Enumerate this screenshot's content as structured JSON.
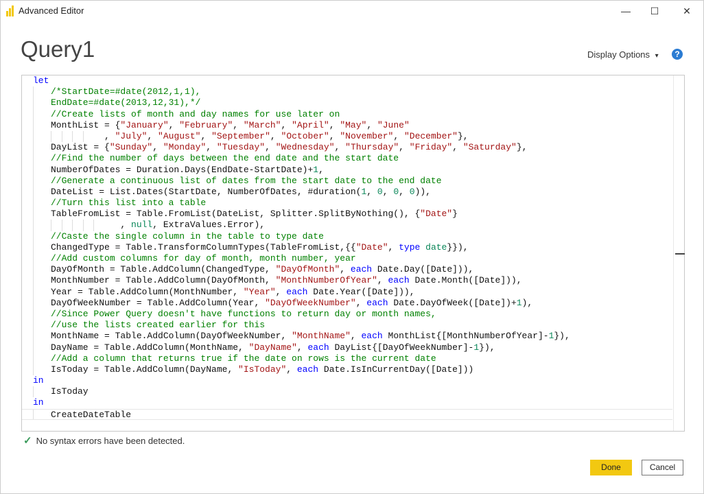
{
  "window": {
    "title": "Advanced Editor",
    "minimize": "—",
    "maximize": "☐",
    "close": "✕"
  },
  "query_title": "Query1",
  "display_options": "Display Options",
  "display_options_caret": "▾",
  "help": "?",
  "colors": {
    "keyword": "#0000ff",
    "comment": "#008000",
    "string": "#a31515",
    "number": "#098658",
    "accent": "#f2c811"
  },
  "code_lines": [
    {
      "i": 0,
      "t": [
        [
          "k",
          "let"
        ]
      ]
    },
    {
      "i": 1,
      "t": [
        [
          "c",
          "/*StartDate=#date(2012,1,1),"
        ]
      ]
    },
    {
      "i": 1,
      "t": [
        [
          "c",
          "EndDate=#date(2013,12,31),*/"
        ]
      ]
    },
    {
      "i": 1,
      "t": [
        [
          "c",
          "//Create lists of month and day names for use later on"
        ]
      ]
    },
    {
      "i": 1,
      "t": [
        [
          "p",
          "MonthList = {"
        ],
        [
          "s",
          "\"January\""
        ],
        [
          "p",
          ", "
        ],
        [
          "s",
          "\"February\""
        ],
        [
          "p",
          ", "
        ],
        [
          "s",
          "\"March\""
        ],
        [
          "p",
          ", "
        ],
        [
          "s",
          "\"April\""
        ],
        [
          "p",
          ", "
        ],
        [
          "s",
          "\"May\""
        ],
        [
          "p",
          ", "
        ],
        [
          "s",
          "\"June\""
        ]
      ]
    },
    {
      "i": 1,
      "g": 4,
      "t": [
        [
          "p",
          "          , "
        ],
        [
          "s",
          "\"July\""
        ],
        [
          "p",
          ", "
        ],
        [
          "s",
          "\"August\""
        ],
        [
          "p",
          ", "
        ],
        [
          "s",
          "\"September\""
        ],
        [
          "p",
          ", "
        ],
        [
          "s",
          "\"October\""
        ],
        [
          "p",
          ", "
        ],
        [
          "s",
          "\"November\""
        ],
        [
          "p",
          ", "
        ],
        [
          "s",
          "\"December\""
        ],
        [
          "p",
          "},"
        ]
      ]
    },
    {
      "i": 1,
      "t": [
        [
          "p",
          "DayList = {"
        ],
        [
          "s",
          "\"Sunday\""
        ],
        [
          "p",
          ", "
        ],
        [
          "s",
          "\"Monday\""
        ],
        [
          "p",
          ", "
        ],
        [
          "s",
          "\"Tuesday\""
        ],
        [
          "p",
          ", "
        ],
        [
          "s",
          "\"Wednesday\""
        ],
        [
          "p",
          ", "
        ],
        [
          "s",
          "\"Thursday\""
        ],
        [
          "p",
          ", "
        ],
        [
          "s",
          "\"Friday\""
        ],
        [
          "p",
          ", "
        ],
        [
          "s",
          "\"Saturday\""
        ],
        [
          "p",
          "},"
        ]
      ]
    },
    {
      "i": 1,
      "t": [
        [
          "c",
          "//Find the number of days between the end date and the start date"
        ]
      ]
    },
    {
      "i": 1,
      "t": [
        [
          "p",
          "NumberOfDates = Duration.Days(EndDate-StartDate)+"
        ],
        [
          "n",
          "1"
        ],
        [
          "p",
          ","
        ]
      ]
    },
    {
      "i": 1,
      "t": [
        [
          "c",
          "//Generate a continuous list of dates from the start date to the end date"
        ]
      ]
    },
    {
      "i": 1,
      "t": [
        [
          "p",
          "DateList = List.Dates(StartDate, NumberOfDates, #duration("
        ],
        [
          "n",
          "1"
        ],
        [
          "p",
          ", "
        ],
        [
          "n",
          "0"
        ],
        [
          "p",
          ", "
        ],
        [
          "n",
          "0"
        ],
        [
          "p",
          ", "
        ],
        [
          "n",
          "0"
        ],
        [
          "p",
          "))"
        ],
        [
          "p",
          ","
        ]
      ]
    },
    {
      "i": 1,
      "t": [
        [
          "c",
          "//Turn this list into a table"
        ]
      ]
    },
    {
      "i": 1,
      "t": [
        [
          "p",
          "TableFromList = Table.FromList(DateList, Splitter.SplitByNothing(), {"
        ],
        [
          "s",
          "\"Date\""
        ],
        [
          "p",
          "}"
        ]
      ]
    },
    {
      "i": 1,
      "g": 5,
      "t": [
        [
          "p",
          "             , "
        ],
        [
          "n",
          "null"
        ],
        [
          "p",
          ", ExtraValues.Error),"
        ]
      ]
    },
    {
      "i": 1,
      "t": [
        [
          "c",
          "//Caste the single column in the table to type date"
        ]
      ]
    },
    {
      "i": 1,
      "t": [
        [
          "p",
          "ChangedType = Table.TransformColumnTypes(TableFromList,{{"
        ],
        [
          "s",
          "\"Date\""
        ],
        [
          "p",
          ", "
        ],
        [
          "k",
          "type"
        ],
        [
          "p",
          " "
        ],
        [
          "n",
          "date"
        ],
        [
          "p",
          "}}),"
        ]
      ]
    },
    {
      "i": 1,
      "t": [
        [
          "c",
          "//Add custom columns for day of month, month number, year"
        ]
      ]
    },
    {
      "i": 1,
      "t": [
        [
          "p",
          "DayOfMonth = Table.AddColumn(ChangedType, "
        ],
        [
          "s",
          "\"DayOfMonth\""
        ],
        [
          "p",
          ", "
        ],
        [
          "k",
          "each"
        ],
        [
          "p",
          " Date.Day([Date])),"
        ]
      ]
    },
    {
      "i": 1,
      "t": [
        [
          "p",
          "MonthNumber = Table.AddColumn(DayOfMonth, "
        ],
        [
          "s",
          "\"MonthNumberOfYear\""
        ],
        [
          "p",
          ", "
        ],
        [
          "k",
          "each"
        ],
        [
          "p",
          " Date.Month([Date])),"
        ]
      ]
    },
    {
      "i": 1,
      "t": [
        [
          "p",
          "Year = Table.AddColumn(MonthNumber, "
        ],
        [
          "s",
          "\"Year\""
        ],
        [
          "p",
          ", "
        ],
        [
          "k",
          "each"
        ],
        [
          "p",
          " Date.Year([Date])),"
        ]
      ]
    },
    {
      "i": 1,
      "t": [
        [
          "p",
          "DayOfWeekNumber = Table.AddColumn(Year, "
        ],
        [
          "s",
          "\"DayOfWeekNumber\""
        ],
        [
          "p",
          ", "
        ],
        [
          "k",
          "each"
        ],
        [
          "p",
          " Date.DayOfWeek([Date])+"
        ],
        [
          "n",
          "1"
        ],
        [
          "p",
          "),"
        ]
      ]
    },
    {
      "i": 1,
      "t": [
        [
          "c",
          "//Since Power Query doesn't have functions to return day or month names,"
        ]
      ]
    },
    {
      "i": 1,
      "t": [
        [
          "c",
          "//use the lists created earlier for this"
        ]
      ]
    },
    {
      "i": 1,
      "t": [
        [
          "p",
          "MonthName = Table.AddColumn(DayOfWeekNumber, "
        ],
        [
          "s",
          "\"MonthName\""
        ],
        [
          "p",
          ", "
        ],
        [
          "k",
          "each"
        ],
        [
          "p",
          " MonthList{[MonthNumberOfYear]-"
        ],
        [
          "n",
          "1"
        ],
        [
          "p",
          "}),"
        ]
      ]
    },
    {
      "i": 1,
      "t": [
        [
          "p",
          "DayName = Table.AddColumn(MonthName, "
        ],
        [
          "s",
          "\"DayName\""
        ],
        [
          "p",
          ", "
        ],
        [
          "k",
          "each"
        ],
        [
          "p",
          " DayList{[DayOfWeekNumber]-"
        ],
        [
          "n",
          "1"
        ],
        [
          "p",
          "}),"
        ]
      ]
    },
    {
      "i": 1,
      "t": [
        [
          "c",
          "//Add a column that returns true if the date on rows is the current date"
        ]
      ]
    },
    {
      "i": 1,
      "t": [
        [
          "p",
          "IsToday = Table.AddColumn(DayName, "
        ],
        [
          "s",
          "\"IsToday\""
        ],
        [
          "p",
          ", "
        ],
        [
          "k",
          "each"
        ],
        [
          "p",
          " Date.IsInCurrentDay([Date]))"
        ]
      ]
    },
    {
      "i": 0,
      "t": [
        [
          "k",
          "in"
        ]
      ]
    },
    {
      "i": 1,
      "t": [
        [
          "p",
          "IsToday"
        ]
      ]
    },
    {
      "i": 0,
      "t": [
        [
          "k",
          "in"
        ]
      ]
    },
    {
      "i": 1,
      "cur": true,
      "t": [
        [
          "p",
          "CreateDateTable"
        ]
      ]
    }
  ],
  "status": {
    "icon": "checkmark-icon",
    "text": "No syntax errors have been detected."
  },
  "buttons": {
    "done": "Done",
    "cancel": "Cancel"
  }
}
